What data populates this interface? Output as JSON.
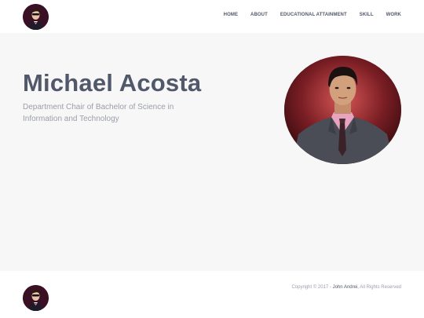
{
  "header": {
    "logo_icon": "avatar-logo-icon",
    "nav": [
      {
        "label": "HOME"
      },
      {
        "label": "ABOUT"
      },
      {
        "label": "EDUCATIONAL ATTAINMENT"
      },
      {
        "label": "SKILL"
      },
      {
        "label": "WORK"
      }
    ]
  },
  "hero": {
    "name": "Michael Acosta",
    "subtitle": "Department Chair of Bachelor of Science in Information and Technology"
  },
  "footer": {
    "logo_icon": "avatar-logo-icon",
    "copyright_prefix": "Copyright © 2017 - ",
    "author": "John Andrei",
    "copyright_suffix": ", All Rights Reserved"
  },
  "colors": {
    "text_dark": "#51586a",
    "text_muted": "#9a9ea8",
    "hero_bg": "#f7f7f7",
    "logo_bg": "#3a1024"
  }
}
